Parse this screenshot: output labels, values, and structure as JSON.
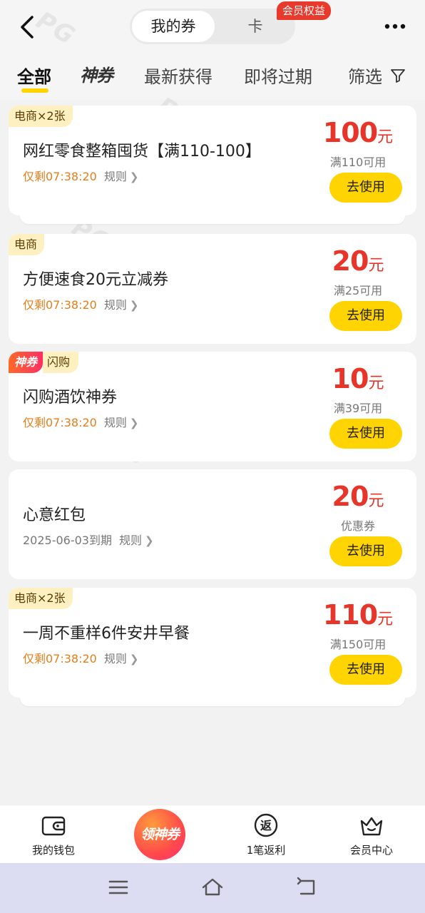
{
  "header": {
    "segments": [
      "我的券",
      "卡"
    ],
    "vip_badge": "会员权益"
  },
  "filters": {
    "tabs": [
      "全部",
      "神券",
      "最新获得",
      "即将过期",
      "筛选"
    ]
  },
  "watermark": "PG",
  "coupons": [
    {
      "tag": "电商×2张",
      "title": "网红零食整箱囤货【满110-100】",
      "expire": "仅剩07:38:20",
      "rule": "规则",
      "amount": "100",
      "unit": "元",
      "condition": "满110可用",
      "button": "去使用"
    },
    {
      "tag": "电商",
      "title": "方便速食20元立减券",
      "expire": "仅剩07:38:20",
      "rule": "规则",
      "amount": "20",
      "unit": "元",
      "condition": "满25可用",
      "button": "去使用"
    },
    {
      "tag_shen": "神券",
      "tag": "闪购",
      "title": "闪购酒饮神券",
      "expire": "仅剩07:38:20",
      "rule": "规则",
      "amount": "10",
      "unit": "元",
      "condition": "满39可用",
      "button": "去使用"
    },
    {
      "title": "心意红包",
      "expire": "2025-06-03到期",
      "rule": "规则",
      "amount": "20",
      "unit": "元",
      "condition": "优惠券",
      "button": "去使用"
    },
    {
      "tag": "电商×2张",
      "title": "一周不重样6件安井早餐",
      "expire": "仅剩07:38:20",
      "rule": "规则",
      "amount": "110",
      "unit": "元",
      "condition": "满150可用",
      "button": "去使用"
    }
  ],
  "bottom_nav": {
    "wallet": "我的钱包",
    "center": "领神券",
    "rebate": "1笔返利",
    "rebate_icon_text": "返",
    "member": "会员中心"
  },
  "colors": {
    "accent_yellow": "#ffd400",
    "price_red": "#e8352a",
    "expire_orange": "#e67e1c",
    "badge_red": "#e83a2c"
  },
  "icons": [
    "back-arrow-icon",
    "more-dots-icon",
    "filter-funnel-icon",
    "wallet-icon",
    "rebate-icon",
    "crown-basket-icon",
    "menu-icon",
    "home-icon",
    "back-icon"
  ]
}
